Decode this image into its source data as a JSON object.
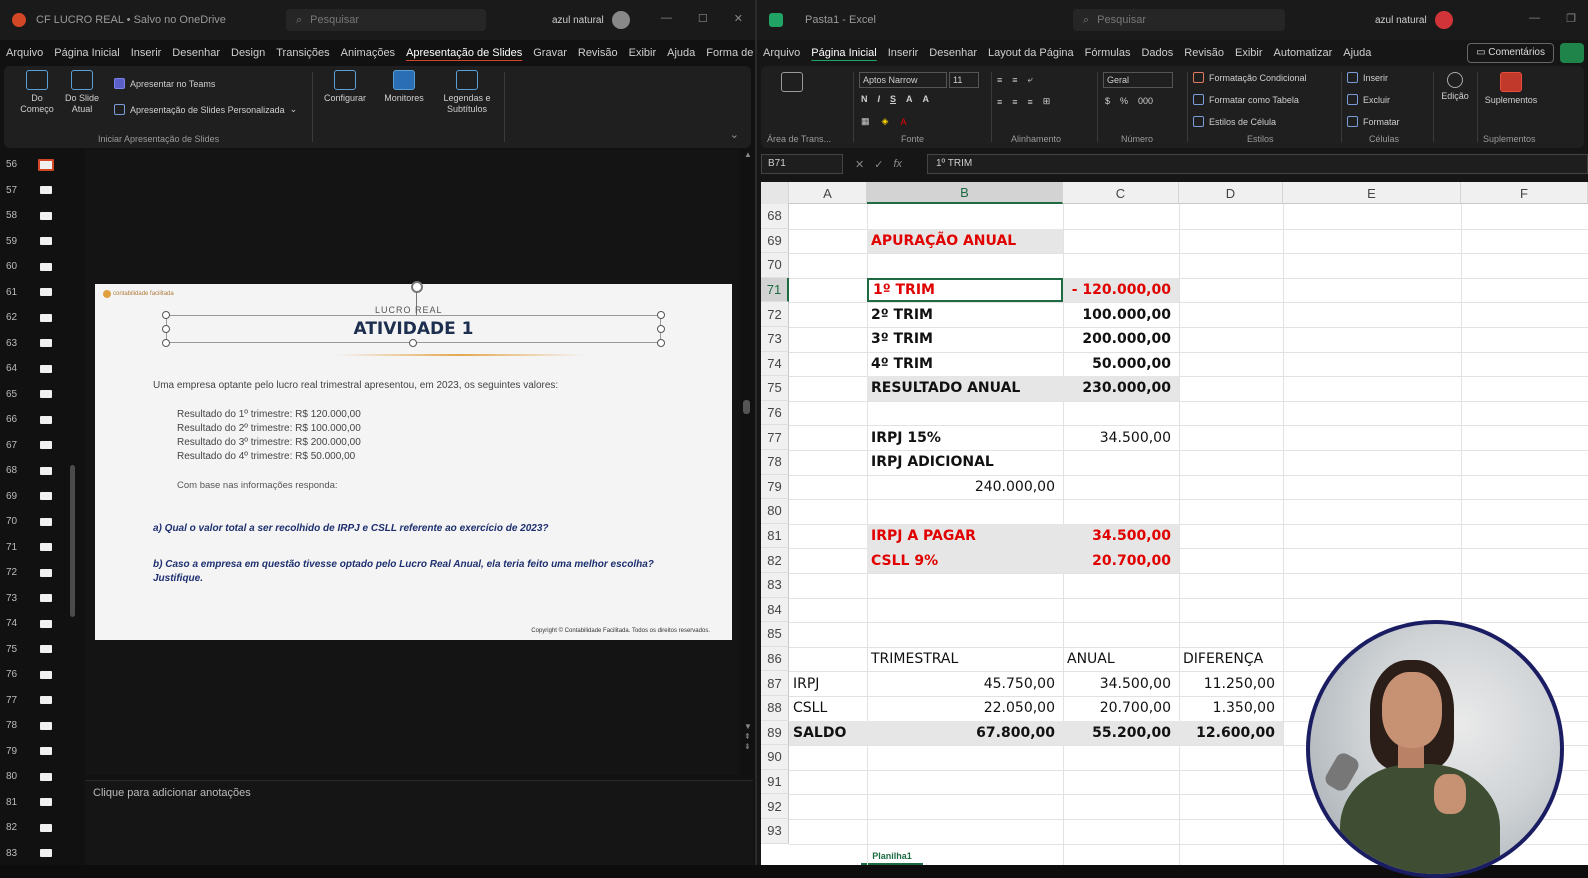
{
  "ppt": {
    "title": "CF LUCRO REAL • Salvo no OneDrive",
    "search_placeholder": "Pesquisar",
    "user": "azul natural",
    "tabs": [
      "Arquivo",
      "Página Inicial",
      "Inserir",
      "Desenhar",
      "Design",
      "Transições",
      "Animações",
      "Apresentação de Slides",
      "Gravar",
      "Revisão",
      "Exibir",
      "Ajuda",
      "Forma de F"
    ],
    "active_tab": "Apresentação de Slides",
    "ribbon": {
      "from_start": "Do Começo",
      "from_current": "Do Slide Atual",
      "present_teams": "Apresentar no Teams",
      "custom_show": "Apresentação de Slides Personalizada",
      "group_start": "Iniciar Apresentação de Slides",
      "configure": "Configurar",
      "monitors": "Monitores",
      "captions": "Legendas e Subtítulos"
    },
    "slide_numbers": [
      "56",
      "57",
      "58",
      "59",
      "60",
      "61",
      "62",
      "63",
      "64",
      "65",
      "66",
      "67",
      "68",
      "69",
      "70",
      "71",
      "72",
      "73",
      "74",
      "75",
      "76",
      "77",
      "78",
      "79",
      "80",
      "81",
      "82",
      "83"
    ],
    "slide": {
      "logo": "contabilidade facilitada",
      "small_title": "LUCRO REAL",
      "title": "ATIVIDADE 1",
      "intro": "Uma empresa optante pelo lucro real trimestral apresentou, em 2023, os seguintes valores:",
      "list": [
        "Resultado do 1º trimestre: R$ 120.000,00",
        "Resultado do 2º trimestre: R$ 100.000,00",
        "Resultado do 3º trimestre: R$ 200.000,00",
        "Resultado do 4º trimestre: R$ 50.000,00"
      ],
      "obs": "Com base nas informações responda:",
      "qa": "a) Qual o valor total a ser recolhido de IRPJ e CSLL referente ao exercício de 2023?",
      "qb": "b) Caso a empresa em questão tivesse optado pelo Lucro Real Anual, ela teria feito uma melhor escolha? Justifique.",
      "copyright": "Copyright © Contabilidade Facilitada. Todos os direitos reservados."
    },
    "notes": "Clique para adicionar anotações"
  },
  "excel": {
    "title": "Pasta1 - Excel",
    "search_placeholder": "Pesquisar",
    "user": "azul natural",
    "tabs": [
      "Arquivo",
      "Página Inicial",
      "Inserir",
      "Desenhar",
      "Layout da Página",
      "Fórmulas",
      "Dados",
      "Revisão",
      "Exibir",
      "Automatizar",
      "Ajuda"
    ],
    "active_tab": "Página Inicial",
    "comments": "Comentários",
    "ribbon": {
      "font": "Aptos Narrow",
      "size": "11",
      "number_format": "Geral",
      "cond_format": "Formatação Condicional",
      "as_table": "Formatar como Tabela",
      "cell_styles": "Estilos de Célula",
      "insert": "Inserir",
      "delete": "Excluir",
      "format": "Formatar",
      "editing": "Edição",
      "addins": "Suplementos",
      "groups": [
        "Área de Trans...",
        "Fonte",
        "Alinhamento",
        "Número",
        "Estilos",
        "Células",
        "Suplementos"
      ]
    },
    "name_box": "B71",
    "formula": "1º TRIM",
    "columns": [
      "A",
      "B",
      "C",
      "D",
      "E",
      "F"
    ],
    "selected_column": "B",
    "rows": [
      "68",
      "69",
      "70",
      "71",
      "72",
      "73",
      "74",
      "75",
      "76",
      "77",
      "78",
      "79",
      "80",
      "81",
      "82",
      "83",
      "84",
      "85",
      "86",
      "87",
      "88",
      "89",
      "90",
      "91",
      "92",
      "93"
    ],
    "selected_row": "71",
    "cells": {
      "b69": "APURAÇÃO ANUAL",
      "b71": "1º TRIM",
      "c71": "-   120.000,00",
      "b72": "2º TRIM",
      "c72": "100.000,00",
      "b73": "3º TRIM",
      "c73": "200.000,00",
      "b74": "4º TRIM",
      "c74": "50.000,00",
      "b75": "RESULTADO ANUAL",
      "c75": "230.000,00",
      "b77": "IRPJ 15%",
      "c77": "34.500,00",
      "b78": "IRPJ ADICIONAL",
      "b79": "240.000,00",
      "b81": "IRPJ A PAGAR",
      "c81": "34.500,00",
      "b82": "CSLL 9%",
      "c82": "20.700,00",
      "b86": "TRIMESTRAL",
      "c86": "ANUAL",
      "d86": "DIFERENÇA",
      "a87": "IRPJ",
      "b87": "45.750,00",
      "c87": "34.500,00",
      "d87": "11.250,00",
      "a88": "CSLL",
      "b88": "22.050,00",
      "c88": "20.700,00",
      "d88": "1.350,00",
      "a89": "SALDO",
      "b89": "67.800,00",
      "c89": "55.200,00",
      "d89": "12.600,00"
    },
    "sheet_tab": "Planilha1"
  },
  "colors": {
    "ppt_accent": "#d24726",
    "excel_accent": "#1e6b43",
    "red_text": "#e00000",
    "highlight": "#e7e6e6"
  }
}
